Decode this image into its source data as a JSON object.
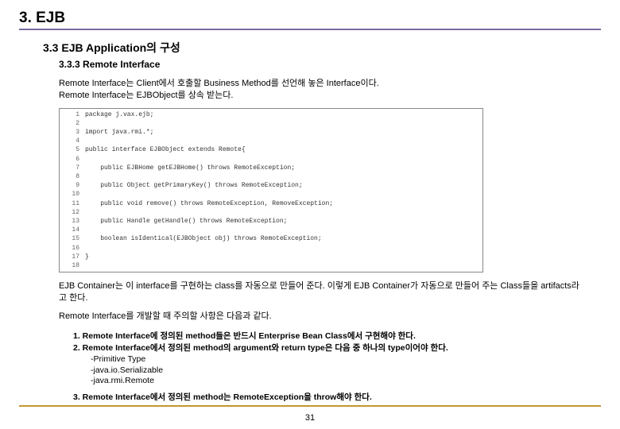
{
  "heading1": "3.  EJB",
  "heading2": "3.3 EJB Application의 구성",
  "heading3": "3.3.3 Remote Interface",
  "intro": {
    "line1": "Remote Interface는 Client에서 호출할 Business Method를 선언해 놓은 Interface이다.",
    "line2": "Remote Interface는 EJBObject를 상속 받는다."
  },
  "code": {
    "lines": [
      {
        "n": "1",
        "t": "package j.vax.ejb;"
      },
      {
        "n": "2",
        "t": ""
      },
      {
        "n": "3",
        "t": "import java.rmi.*;"
      },
      {
        "n": "4",
        "t": ""
      },
      {
        "n": "5",
        "t": "public interface EJBObject extends Remote{"
      },
      {
        "n": "6",
        "t": ""
      },
      {
        "n": "7",
        "t": "    public EJBHome getEJBHome() throws RemoteException;"
      },
      {
        "n": "8",
        "t": ""
      },
      {
        "n": "9",
        "t": "    public Object getPrimaryKey() throws RemoteException;"
      },
      {
        "n": "10",
        "t": ""
      },
      {
        "n": "11",
        "t": "    public void remove() throws RemoteException, RemoveException;"
      },
      {
        "n": "12",
        "t": ""
      },
      {
        "n": "13",
        "t": "    public Handle getHandle() throws RemoteException;"
      },
      {
        "n": "14",
        "t": ""
      },
      {
        "n": "15",
        "t": "    boolean isIdentical(EJBObject obj) throws RemoteException;"
      },
      {
        "n": "16",
        "t": ""
      },
      {
        "n": "17",
        "t": "}"
      },
      {
        "n": "18",
        "t": ""
      }
    ]
  },
  "afterCode": {
    "p1": "EJB Container는 이 interface를 구현하는 class를 자동으로 만들어 준다. 이렇게 EJB Container가 자동으로 만들어 주는 Class들을 artifacts라고 한다.",
    "p2": "Remote Interface를 개발할 때 주의할 사항은 다음과 같다."
  },
  "notes": {
    "n1": "1. Remote Interface에 정의된 method들은 반드시 Enterprise Bean Class에서 구현해야 한다.",
    "n2": "2. Remote Interface에서 정의된 method의 argument와 return type은 다음 중 하나의 type이어야 한다.",
    "sub1": "-Primitive Type",
    "sub2": "-java.io.Serializable",
    "sub3": "-java.rmi.Remote",
    "n3": "3. Remote Interface에서 정의된 method는 RemoteException을 throw해야 한다."
  },
  "pageNumber": "31"
}
